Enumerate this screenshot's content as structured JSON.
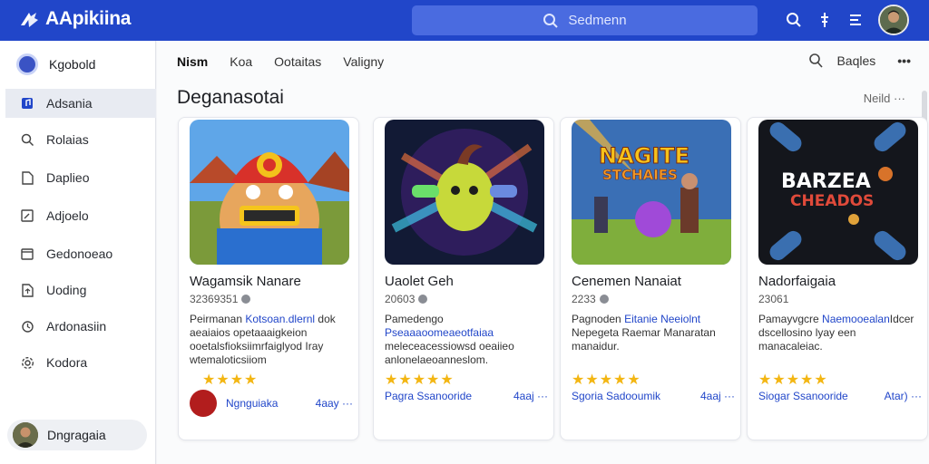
{
  "app": {
    "title": "AApikiina"
  },
  "search": {
    "placeholder": "Sedmenn"
  },
  "sidebar": {
    "account": "Kgobold",
    "items": [
      {
        "label": "Adsania",
        "icon": "music-icon",
        "active": true
      },
      {
        "label": "Rolaias",
        "icon": "search-icon"
      },
      {
        "label": "Daplieo",
        "icon": "document-icon"
      },
      {
        "label": "Adjoelo",
        "icon": "edit-icon"
      },
      {
        "label": "Gedonoeao",
        "icon": "calendar-icon"
      },
      {
        "label": "Uoding",
        "icon": "upload-icon"
      },
      {
        "label": "Ardonasiin",
        "icon": "refresh-icon"
      },
      {
        "label": "Kodora",
        "icon": "gear-icon"
      }
    ],
    "user": "Dngragaia"
  },
  "tabs": [
    {
      "label": "Nism",
      "active": true
    },
    {
      "label": "Koa"
    },
    {
      "label": "Ootaitas"
    },
    {
      "label": "Valigny"
    }
  ],
  "header_right": {
    "label": "Baqles",
    "more": "•••"
  },
  "section": {
    "title": "Deganasotai",
    "more": "Neild ···"
  },
  "cards": [
    {
      "title": "Wagamsik Nanare",
      "meta": "32369351",
      "desc_a": "Peirmanan ",
      "desc_hl": "Kotsoan.dlernl",
      "desc_b": " dok aeaiaios opetaaaigkeion ooetalsfioksiimrfaiglyod Iray wtemaloticsiiom",
      "stars": "★★★★",
      "foot_left": "Ngnguiaka",
      "foot_right": "4aay ···"
    },
    {
      "title": "Uaolet Geh",
      "meta": "20603",
      "desc_a": "Pamedengo ",
      "desc_hl": "Pseaaaoomeaeotfaiaa",
      "desc_b": " meleceacessiowsd oeaiieo anlonelaeoanneslom.",
      "stars": "★★★★★",
      "foot_left": "Pagra Ssanooride",
      "foot_right": "4aaj ···"
    },
    {
      "title": "Cenemen Nanaiat",
      "meta": "2233",
      "desc_a": "Pagnoden ",
      "desc_hl": "Eitanie Neeiolnt",
      "desc_b": " Nepegeta Raemar Manaratan manaidur.",
      "stars": "★★★★★",
      "foot_left": "Sgoria Sadooumik",
      "foot_right": "4aaj ···"
    },
    {
      "title": "Nadorfaigaia",
      "meta": "23061",
      "desc_a": "Pamayvgcre ",
      "desc_hl": "Naemooealan",
      "desc_b": "Idcer dscellosino lyay een manacaleiac.",
      "stars": "★★★★★",
      "foot_left": "Siogar Ssanooride",
      "foot_right": "Atar) ···"
    }
  ],
  "colors": {
    "brand": "#2146c9",
    "star": "#f3b613"
  }
}
